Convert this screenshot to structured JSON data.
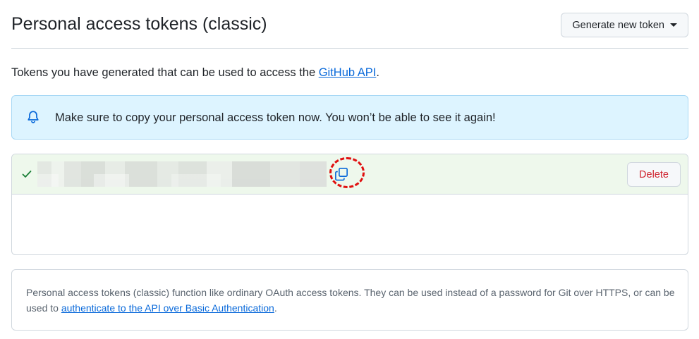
{
  "header": {
    "title": "Personal access tokens (classic)",
    "generate_button": "Generate new token"
  },
  "intro": {
    "text_before": "Tokens you have generated that can be used to access the ",
    "link": "GitHub API",
    "text_after": "."
  },
  "flash": {
    "message": "Make sure to copy your personal access token now. You won’t be able to see it again!",
    "icon": "bell-icon"
  },
  "token": {
    "status_icon": "check-icon",
    "value_redacted": true,
    "copy_icon": "copy-icon",
    "delete_label": "Delete"
  },
  "info": {
    "text_before": "Personal access tokens (classic) function like ordinary OAuth access tokens. They can be used instead of a password for Git over HTTPS, or can be used to ",
    "link": "authenticate to the API over Basic Authentication",
    "text_after": "."
  },
  "colors": {
    "accent_link": "#0969da",
    "flash_bg": "#ddf4ff",
    "token_row_bg": "#eef8ec",
    "success": "#1a7f37",
    "danger": "#cf222e",
    "highlight_ring": "#e01010"
  }
}
